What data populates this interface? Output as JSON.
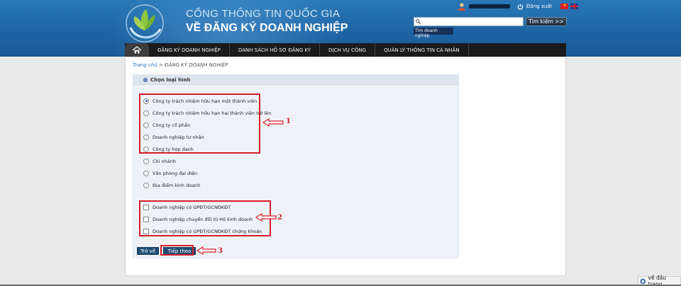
{
  "header": {
    "title_line1": "CỔNG THÔNG TIN QUỐC GIA",
    "title_line2": "VỀ ĐĂNG KÝ DOANH NGHIỆP",
    "logout_label": "Đăng xuất",
    "search_placeholder": "",
    "search_button_label": "Tìm kiếm >>",
    "search_sub_label": "Tìm doanh nghiệp"
  },
  "nav": {
    "items": [
      {
        "label": "ĐĂNG KÝ DOANH NGHIỆP"
      },
      {
        "label": "DANH SÁCH HỒ SƠ ĐĂNG KÝ"
      },
      {
        "label": "DỊCH VỤ CÔNG"
      },
      {
        "label": "QUẢN LÝ THÔNG TIN CÁ NHÂN"
      }
    ]
  },
  "breadcrumb": {
    "home": "Trang chủ",
    "separator": " > ",
    "current": "ĐĂNG KÝ DOANH NGHIỆP"
  },
  "panel": {
    "title": "Chọn loại hình",
    "radio_options": [
      {
        "label": "Công ty trách nhiệm hữu hạn một thành viên",
        "checked": true
      },
      {
        "label": "Công ty trách nhiệm hữu hạn hai thành viên trở lên",
        "checked": false
      },
      {
        "label": "Công ty cổ phần",
        "checked": false
      },
      {
        "label": "Doanh nghiệp tư nhân",
        "checked": false
      },
      {
        "label": "Công ty hợp danh",
        "checked": false
      },
      {
        "label": "Chi nhánh",
        "checked": false
      },
      {
        "label": "Văn phòng đại diện",
        "checked": false
      },
      {
        "label": "Địa điểm kinh doanh",
        "checked": false
      }
    ],
    "checkbox_options": [
      {
        "label": "Doanh nghiệp có GPĐT/GCNĐKĐT",
        "checked": false
      },
      {
        "label": "Doanh nghiệp chuyển đổi từ Hộ kinh doanh",
        "checked": false
      },
      {
        "label": "Doanh nghiệp có GPĐT/GCNĐKĐT chứng khoán",
        "checked": false
      }
    ],
    "back_label": "Trở về",
    "next_label": "Tiếp theo"
  },
  "annotations": {
    "label_1": "1",
    "label_2": "2",
    "label_3": "3",
    "color": "#d71f2a"
  },
  "footer": {
    "back_to_top": "về đầu trang"
  },
  "icons": {
    "home": "home-icon",
    "search": "search-icon",
    "user": "user-icon",
    "power": "power-icon",
    "back_to_top": "up-arrow-icon"
  }
}
